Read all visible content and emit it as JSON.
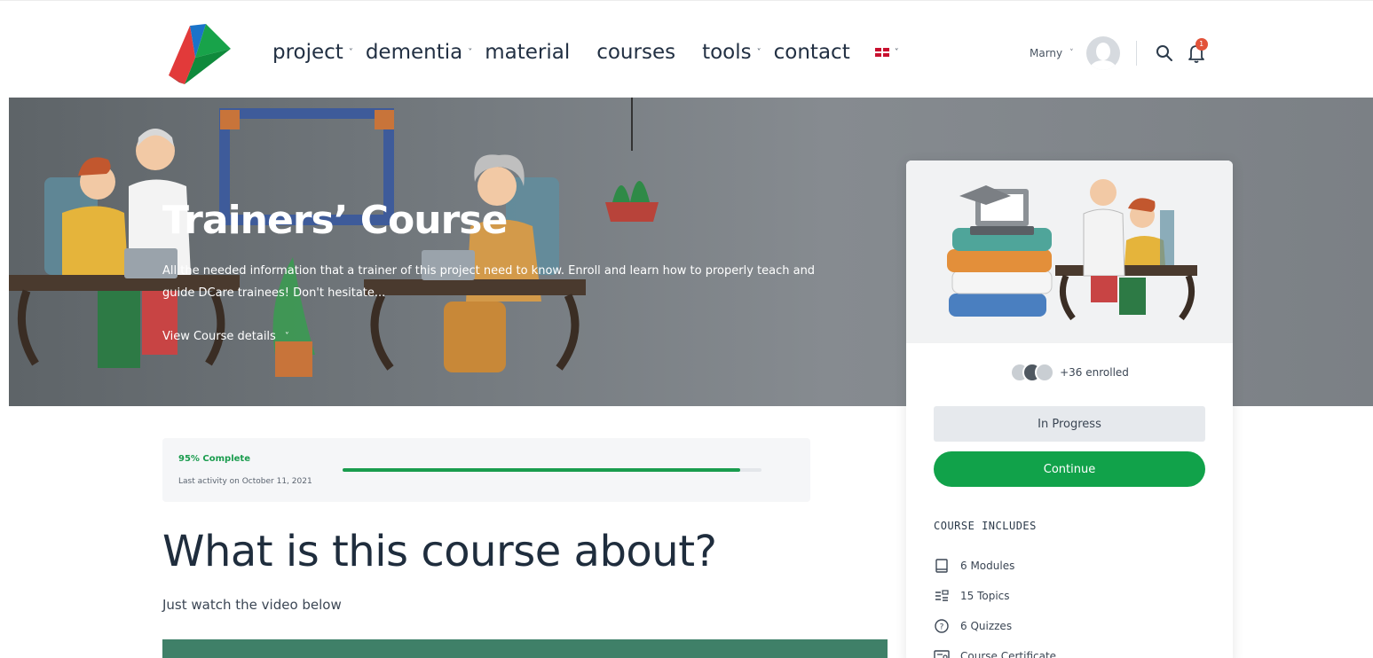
{
  "nav": {
    "items": [
      {
        "label": "project",
        "chevron": true
      },
      {
        "label": "dementia",
        "chevron": true
      },
      {
        "label": "material",
        "chevron": false
      },
      {
        "label": "courses",
        "chevron": false
      },
      {
        "label": "tools",
        "chevron": true
      },
      {
        "label": "contact",
        "chevron": false
      }
    ],
    "language_icon": "uk-flag-icon",
    "chevron_glyph": "˅"
  },
  "user": {
    "name": "Marny",
    "notification_count": "1"
  },
  "hero": {
    "title": "Trainers’ Course",
    "description": "All the needed information that a trainer of this project need to know.  Enroll and learn how to properly teach and guide  DCare trainees!  Don't hesitate...",
    "details_link": "View Course details"
  },
  "progress": {
    "percent_label": "95% Complete",
    "percent_value": 95,
    "last_activity": "Last activity on October 11, 2021"
  },
  "about": {
    "title": "What is this course about?",
    "subtitle": "Just watch the video below"
  },
  "sidebar": {
    "enrolled_text": "+36 enrolled",
    "status_label": "In Progress",
    "continue_label": "Continue",
    "includes_title": "COURSE INCLUDES",
    "includes": [
      {
        "icon": "book-icon",
        "label": "6 Modules"
      },
      {
        "icon": "topics-icon",
        "label": "15 Topics"
      },
      {
        "icon": "quiz-icon",
        "label": "6 Quizzes"
      },
      {
        "icon": "certificate-icon",
        "label": "Course Certificate"
      }
    ]
  },
  "colors": {
    "accent_green": "#11a24a",
    "video_bar": "#3f8068",
    "badge_red": "#e2533a"
  }
}
